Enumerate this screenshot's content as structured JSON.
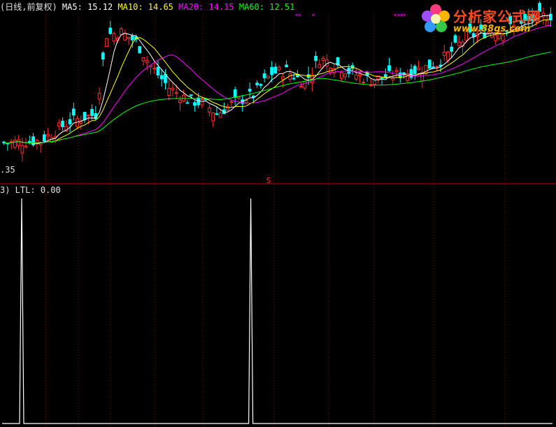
{
  "header": {
    "period": "(日线,前复权)",
    "ma5": {
      "label": "MA5:",
      "value": "15.12",
      "color": "#ffffff"
    },
    "ma10": {
      "label": "MA10:",
      "value": "14.65",
      "color": "#ffff00"
    },
    "ma20": {
      "label": "MA20:",
      "value": "14.15",
      "color": "#ff00ff"
    },
    "ma60": {
      "label": "MA60:",
      "value": "12.51",
      "color": "#00ff00"
    }
  },
  "price_axis": {
    "low_label": ".35"
  },
  "indicator": {
    "label": "3) LTL:",
    "value": "0.00"
  },
  "marker": {
    "symbol": "S"
  },
  "watermark": {
    "title": "分析家公式网",
    "url": "www.88gs.com"
  },
  "chart_data": [
    {
      "type": "candlestick",
      "panel": "price",
      "ylim": [
        11.5,
        17.6
      ],
      "n": 150,
      "close_path": [
        [
          0,
          12.3
        ],
        [
          10,
          12.4
        ],
        [
          18,
          13.2
        ],
        [
          25,
          13.5
        ],
        [
          28,
          16.8
        ],
        [
          32,
          16.9
        ],
        [
          36,
          16.5
        ],
        [
          40,
          15.5
        ],
        [
          45,
          14.6
        ],
        [
          50,
          14.1
        ],
        [
          55,
          13.9
        ],
        [
          58,
          13.5
        ],
        [
          63,
          14.0
        ],
        [
          68,
          14.3
        ],
        [
          73,
          15.2
        ],
        [
          77,
          15.3
        ],
        [
          82,
          14.8
        ],
        [
          86,
          15.8
        ],
        [
          90,
          15.6
        ],
        [
          95,
          15.2
        ],
        [
          100,
          14.9
        ],
        [
          106,
          15.1
        ],
        [
          112,
          15.3
        ],
        [
          118,
          15.6
        ],
        [
          122,
          16.1
        ],
        [
          126,
          16.7
        ],
        [
          131,
          16.9
        ],
        [
          136,
          17.0
        ],
        [
          141,
          17.2
        ],
        [
          145,
          17.5
        ],
        [
          149,
          17.6
        ]
      ],
      "up_color": "#ff3030",
      "down_color": "#00ffff"
    },
    {
      "type": "line",
      "panel": "price",
      "series": [
        {
          "name": "MA5",
          "period": 5,
          "color": "#ffffff"
        },
        {
          "name": "MA10",
          "period": 10,
          "color": "#ffff00"
        },
        {
          "name": "MA20",
          "period": 20,
          "color": "#ff00ff"
        },
        {
          "name": "MA60",
          "period": 60,
          "color": "#00ff00"
        }
      ]
    },
    {
      "type": "line",
      "panel": "indicator",
      "series": [
        {
          "name": "LTL",
          "color": "#ffffff",
          "spikes_at": [
            5,
            68
          ],
          "spike_value": 1,
          "base_value": 0
        }
      ]
    }
  ]
}
